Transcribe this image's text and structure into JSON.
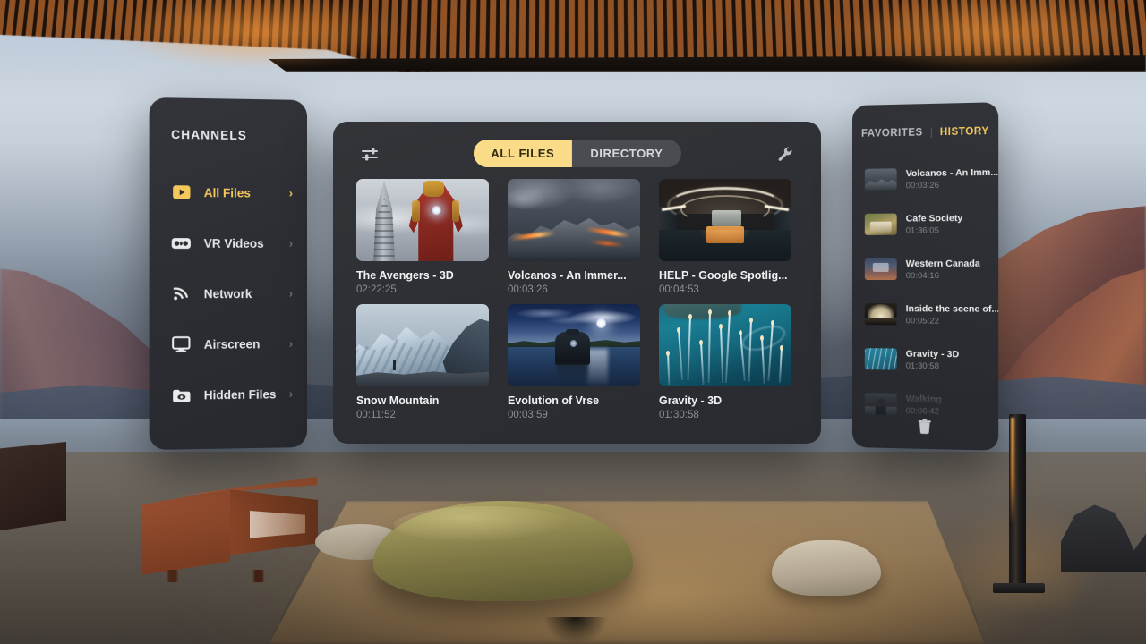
{
  "sidebar": {
    "title": "CHANNELS",
    "items": [
      {
        "label": "All Files",
        "icon": "play-box-icon",
        "active": true,
        "arrow": "›"
      },
      {
        "label": "VR Videos",
        "icon": "vr-goggles-icon",
        "active": false,
        "arrow": "›"
      },
      {
        "label": "Network",
        "icon": "wifi-icon",
        "active": false,
        "arrow": "›"
      },
      {
        "label": "Airscreen",
        "icon": "monitor-icon",
        "active": false,
        "arrow": "›"
      },
      {
        "label": "Hidden Files",
        "icon": "hidden-eye-icon",
        "active": false,
        "arrow": "›"
      }
    ]
  },
  "main": {
    "toolbar": {
      "filter_icon": "sliders-icon",
      "settings_icon": "wrench-icon",
      "tabs": [
        {
          "label": "ALL FILES",
          "active": true
        },
        {
          "label": "DIRECTORY",
          "active": false
        }
      ]
    },
    "files": [
      {
        "title": "The Avengers - 3D",
        "duration": "02:22:25",
        "art": "avengers"
      },
      {
        "title": "Volcanos - An Immer...",
        "duration": "00:03:26",
        "art": "volcano"
      },
      {
        "title": "HELP - Google Spotlig...",
        "duration": "00:04:53",
        "art": "help"
      },
      {
        "title": "Snow Mountain",
        "duration": "00:11:52",
        "art": "snow"
      },
      {
        "title": "Evolution of Vrse",
        "duration": "00:03:59",
        "art": "evolution"
      },
      {
        "title": "Gravity - 3D",
        "duration": "01:30:58",
        "art": "gravity"
      }
    ]
  },
  "right_panel": {
    "tabs": [
      {
        "label": "FAVORITES",
        "active": false
      },
      {
        "label": "HISTORY",
        "active": true
      }
    ],
    "divider": "|",
    "items": [
      {
        "title": "Volcanos - An Imm...",
        "duration": "00:03:26",
        "art": "t-volcano"
      },
      {
        "title": "Cafe Society",
        "duration": "01:36:05",
        "art": "t-cafe"
      },
      {
        "title": "Western Canada",
        "duration": "00:04:16",
        "art": "t-canada"
      },
      {
        "title": "Inside the scene of...",
        "duration": "00:05:22",
        "art": "t-dome"
      },
      {
        "title": "Gravity - 3D",
        "duration": "01:30:58",
        "art": "t-gravity"
      },
      {
        "title": "Walking",
        "duration": "00:06:42",
        "art": "t-walking"
      }
    ],
    "clear_icon": "trash-icon"
  },
  "colors": {
    "accent": "#f6c75a",
    "tab_active_bg": "#fadc88",
    "panel_bg": "#2e3035",
    "text_primary": "#f0f1f2",
    "text_secondary": "#8d8f94"
  }
}
